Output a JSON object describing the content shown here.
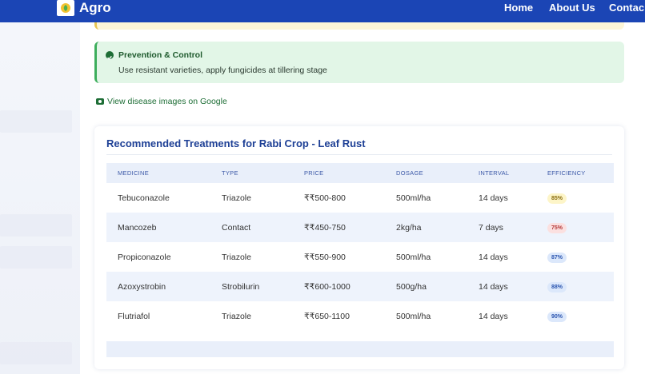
{
  "nav": {
    "brand": "Agro",
    "links": [
      "Home",
      "About Us",
      "Contac"
    ]
  },
  "prevention": {
    "title": "Prevention & Control",
    "text": "Use resistant varieties, apply fungicides at tillering stage"
  },
  "disease_link": "View disease images on Google",
  "treatments": {
    "title": "Recommended Treatments for Rabi Crop - Leaf Rust",
    "headers": [
      "MEDICINE",
      "TYPE",
      "PRICE",
      "DOSAGE",
      "INTERVAL",
      "EFFICIENCY"
    ],
    "rows": [
      {
        "medicine": "Tebuconazole",
        "type": "Triazole",
        "price": "₹₹500-800",
        "dosage": "500ml/ha",
        "interval": "14 days",
        "efficiency": "85%",
        "eff_bg": "#fdf5c8",
        "eff_fg": "#8a6d10"
      },
      {
        "medicine": "Mancozeb",
        "type": "Contact",
        "price": "₹₹450-750",
        "dosage": "2kg/ha",
        "interval": "7 days",
        "efficiency": "75%",
        "eff_bg": "#fbe0e0",
        "eff_fg": "#b43a3a"
      },
      {
        "medicine": "Propiconazole",
        "type": "Triazole",
        "price": "₹₹550-900",
        "dosage": "500ml/ha",
        "interval": "14 days",
        "efficiency": "87%",
        "eff_bg": "#dce8fb",
        "eff_fg": "#2d56b0"
      },
      {
        "medicine": "Azoxystrobin",
        "type": "Strobilurin",
        "price": "₹₹600-1000",
        "dosage": "500g/ha",
        "interval": "14 days",
        "efficiency": "88%",
        "eff_bg": "#dce8fb",
        "eff_fg": "#2d56b0"
      },
      {
        "medicine": "Flutriafol",
        "type": "Triazole",
        "price": "₹₹650-1100",
        "dosage": "500ml/ha",
        "interval": "14 days",
        "efficiency": "90%",
        "eff_bg": "#dce8fb",
        "eff_fg": "#2d56b0"
      }
    ]
  },
  "colors": {
    "navbar": "#1b45b5",
    "accent_green": "#3dae5c",
    "title_blue": "#1d3f95"
  }
}
